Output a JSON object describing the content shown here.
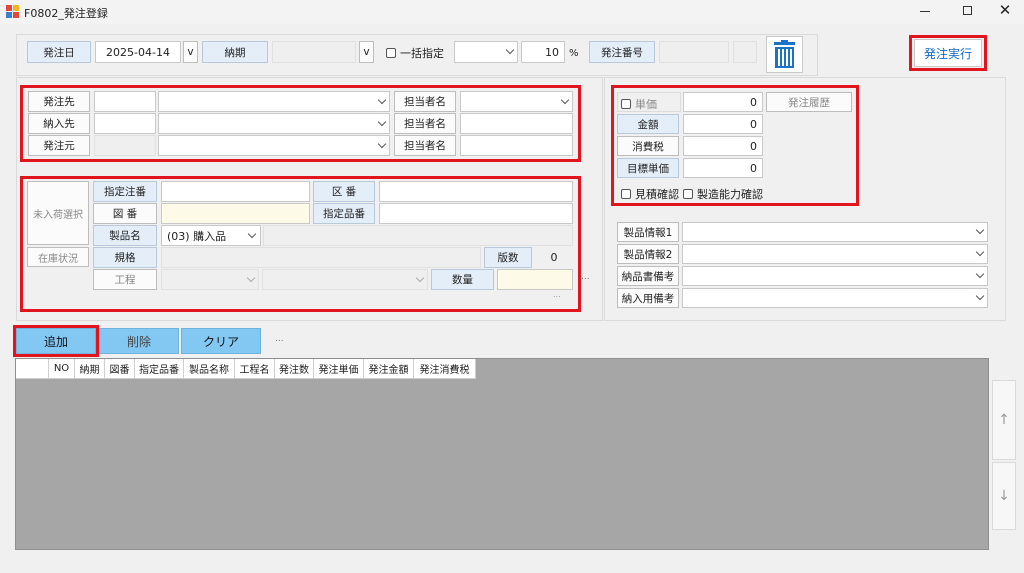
{
  "window": {
    "title": "F0802_発注登録"
  },
  "header": {
    "order_date_label": "発注日",
    "order_date_value": "2025-04-14",
    "order_date_v": "v",
    "delivery_label": "納期",
    "delivery_v": "v",
    "bulk_label": "一括指定",
    "tax_rate_value": "10",
    "percent": "%",
    "order_no_label": "発注番号",
    "execute_button": "発注実行"
  },
  "parties": {
    "supplier_label": "発注先",
    "deliver_to_label": "納入先",
    "ordering_from_label": "発注元",
    "person_label_1": "担当者名",
    "person_label_2": "担当者名",
    "person_label_3": "担当者名"
  },
  "product": {
    "unreceived_button": "未入荷選択",
    "stock_button": "在庫状況",
    "designated_order_no_label": "指定注番",
    "section_no_label": "区 番",
    "drawing_no_label": "図 番",
    "designated_item_label": "指定品番",
    "product_name_label": "製品名",
    "product_type_value": "(03) 購入品",
    "spec_label": "規格",
    "revision_label": "版数",
    "revision_value": "0",
    "process_label": "工程",
    "quantity_label": "数量",
    "dots": "...",
    "dots_small": "..."
  },
  "price": {
    "unit_price_label": "単価",
    "unit_price_value": "0",
    "history_button": "発注履歴",
    "amount_label": "金額",
    "amount_value": "0",
    "tax_label": "消費税",
    "tax_value": "0",
    "target_price_label": "目標単価",
    "target_price_value": "0",
    "estimate_check_label": "見積確認",
    "capacity_check_label": "製造能力確認"
  },
  "info": {
    "info1_label": "製品情報1",
    "info2_label": "製品情報2",
    "delivery_note_label": "納品書備考",
    "delivery_remark_label": "納入用備考"
  },
  "actions": {
    "add": "追加",
    "delete": "削除",
    "clear": "クリア",
    "more": "..."
  },
  "grid": {
    "columns": [
      "",
      "NO",
      "納期",
      "図番",
      "指定品番",
      "製品名称",
      "工程名",
      "発注数",
      "発注単価",
      "発注金額",
      "発注消費税"
    ]
  },
  "scroll": {
    "up": "↑",
    "down": "↓"
  },
  "colors": {
    "red_highlight": "#e0151e",
    "button_blue": "#83c8f3",
    "grid_gray": "#a6a6a6",
    "accent_blue": "#1068c8"
  }
}
